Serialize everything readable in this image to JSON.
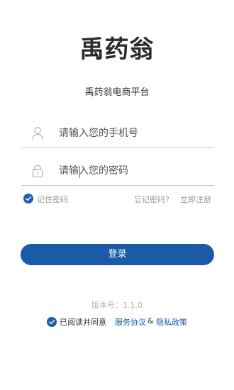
{
  "app": {
    "logo_text": "禹药翁",
    "subtitle": "禹药翁电商平台"
  },
  "login_form": {
    "phone": {
      "placeholder": "请输入您的手机号",
      "value": "",
      "icon": "user-icon"
    },
    "password": {
      "placeholder": "请输入您的密码",
      "value": "",
      "icon": "lock-icon"
    },
    "remember_password": {
      "label": "记住密码",
      "checked": true
    },
    "forgot_password": "忘记密码?",
    "register": "立即注册",
    "submit_label": "登录"
  },
  "footer": {
    "version": "版本号：1.1.0",
    "agreement": {
      "checked": true,
      "prefix": "已阅读并同意",
      "service_link": "服务协议",
      "separator": "&",
      "privacy_link": "隐私政策"
    }
  },
  "colors": {
    "accent": "#1a5aa6",
    "muted": "#9a9a9a"
  }
}
